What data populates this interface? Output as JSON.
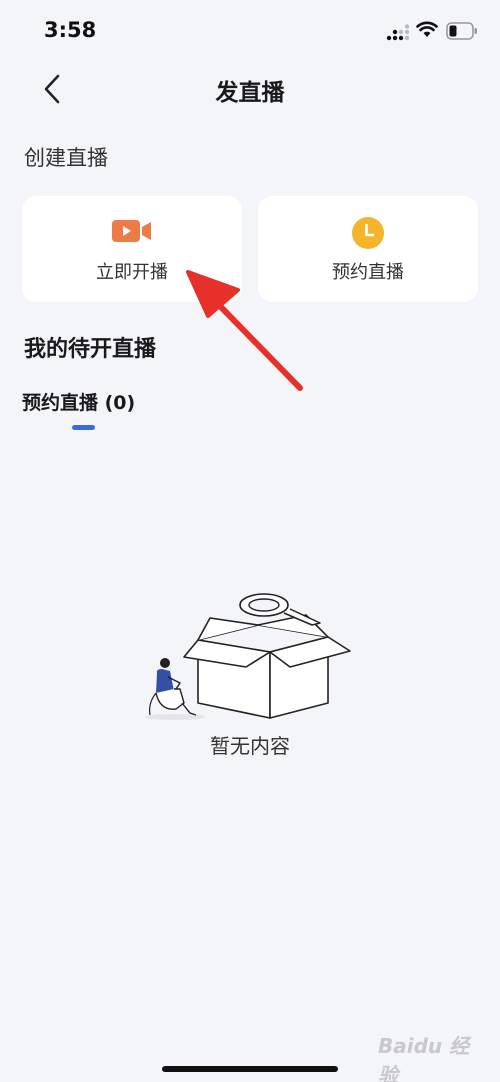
{
  "status_bar": {
    "time": "3:58",
    "icons": [
      "cellular-signal-icon",
      "wifi-icon",
      "battery-icon"
    ]
  },
  "nav": {
    "title": "发直播",
    "back_icon": "chevron-left-icon"
  },
  "create_section": {
    "heading": "创建直播",
    "cards": [
      {
        "label": "立即开播",
        "icon": "video-camera-icon",
        "icon_color": "#ec7b45"
      },
      {
        "label": "预约直播",
        "icon": "clock-icon",
        "icon_color": "#f3b52c"
      }
    ]
  },
  "pending_section": {
    "heading": "我的待开直播",
    "tabs": [
      {
        "label": "预约直播 (0)",
        "active": true,
        "indicator_color": "#3d6bdc"
      }
    ]
  },
  "empty_state": {
    "icon": "empty-box-magnifier-illustration",
    "text": "暂无内容"
  },
  "annotation": {
    "icon": "red-arrow-annotation",
    "color": "#e8302b"
  },
  "watermark": {
    "text": "Baidu 经验"
  }
}
